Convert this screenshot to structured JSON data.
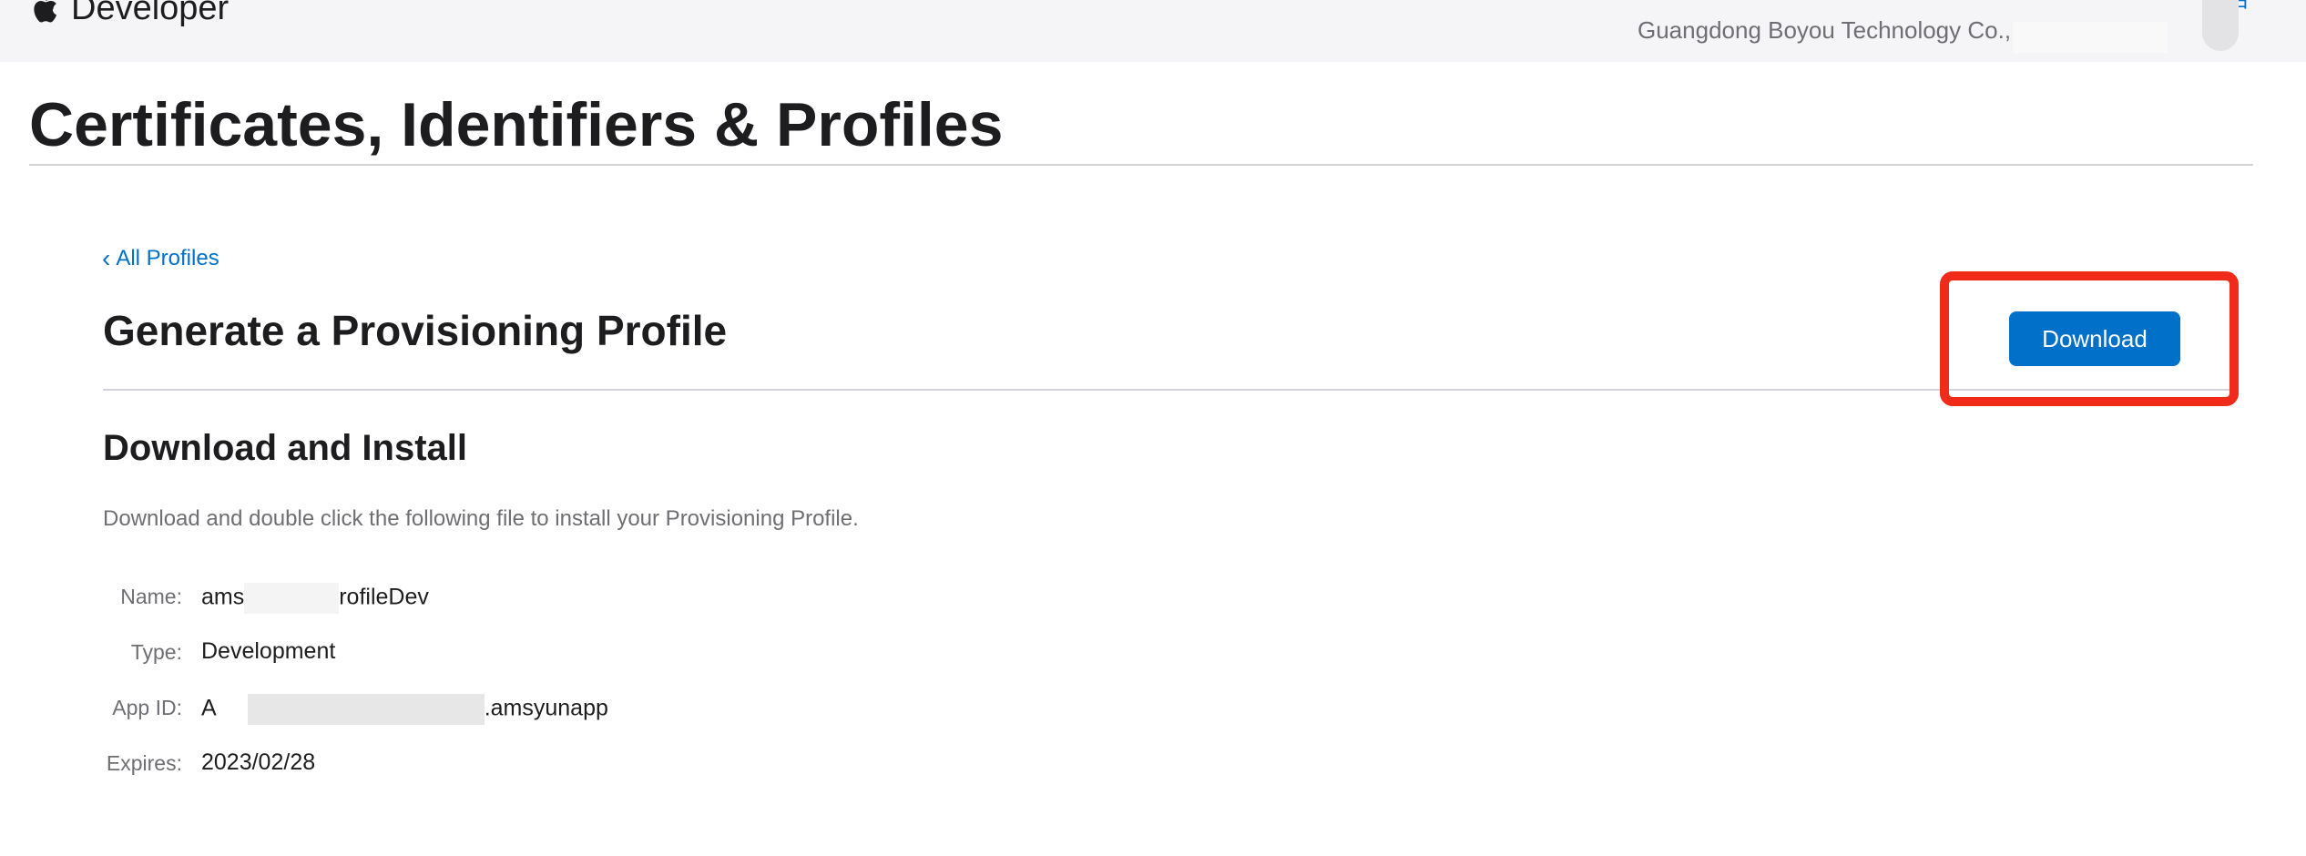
{
  "header": {
    "brand": "Developer",
    "account_link": "账户",
    "team_name": "Guangdong Boyou Technology Co.,"
  },
  "page": {
    "title": "Certificates, Identifiers & Profiles"
  },
  "main": {
    "back_link": "All Profiles",
    "section_title": "Generate a Provisioning Profile",
    "download_button": "Download",
    "subsection_title": "Download and Install",
    "instruction": "Download and double click the following file to install your Provisioning Profile."
  },
  "profile": {
    "name_label": "Name:",
    "name_prefix": "ams",
    "name_suffix": "rofileDev",
    "type_label": "Type:",
    "type_value": "Development",
    "appid_label": "App ID:",
    "appid_prefix": "A",
    "appid_suffix": ".amsyunapp",
    "expires_label": "Expires:",
    "expires_value": "2023/02/28"
  },
  "colors": {
    "accent": "#0070c9",
    "highlight": "#f02b1a",
    "header_bg": "#f5f5f7"
  },
  "icons": {
    "apple": "apple-logo-icon",
    "back": "chevron-left-icon"
  }
}
